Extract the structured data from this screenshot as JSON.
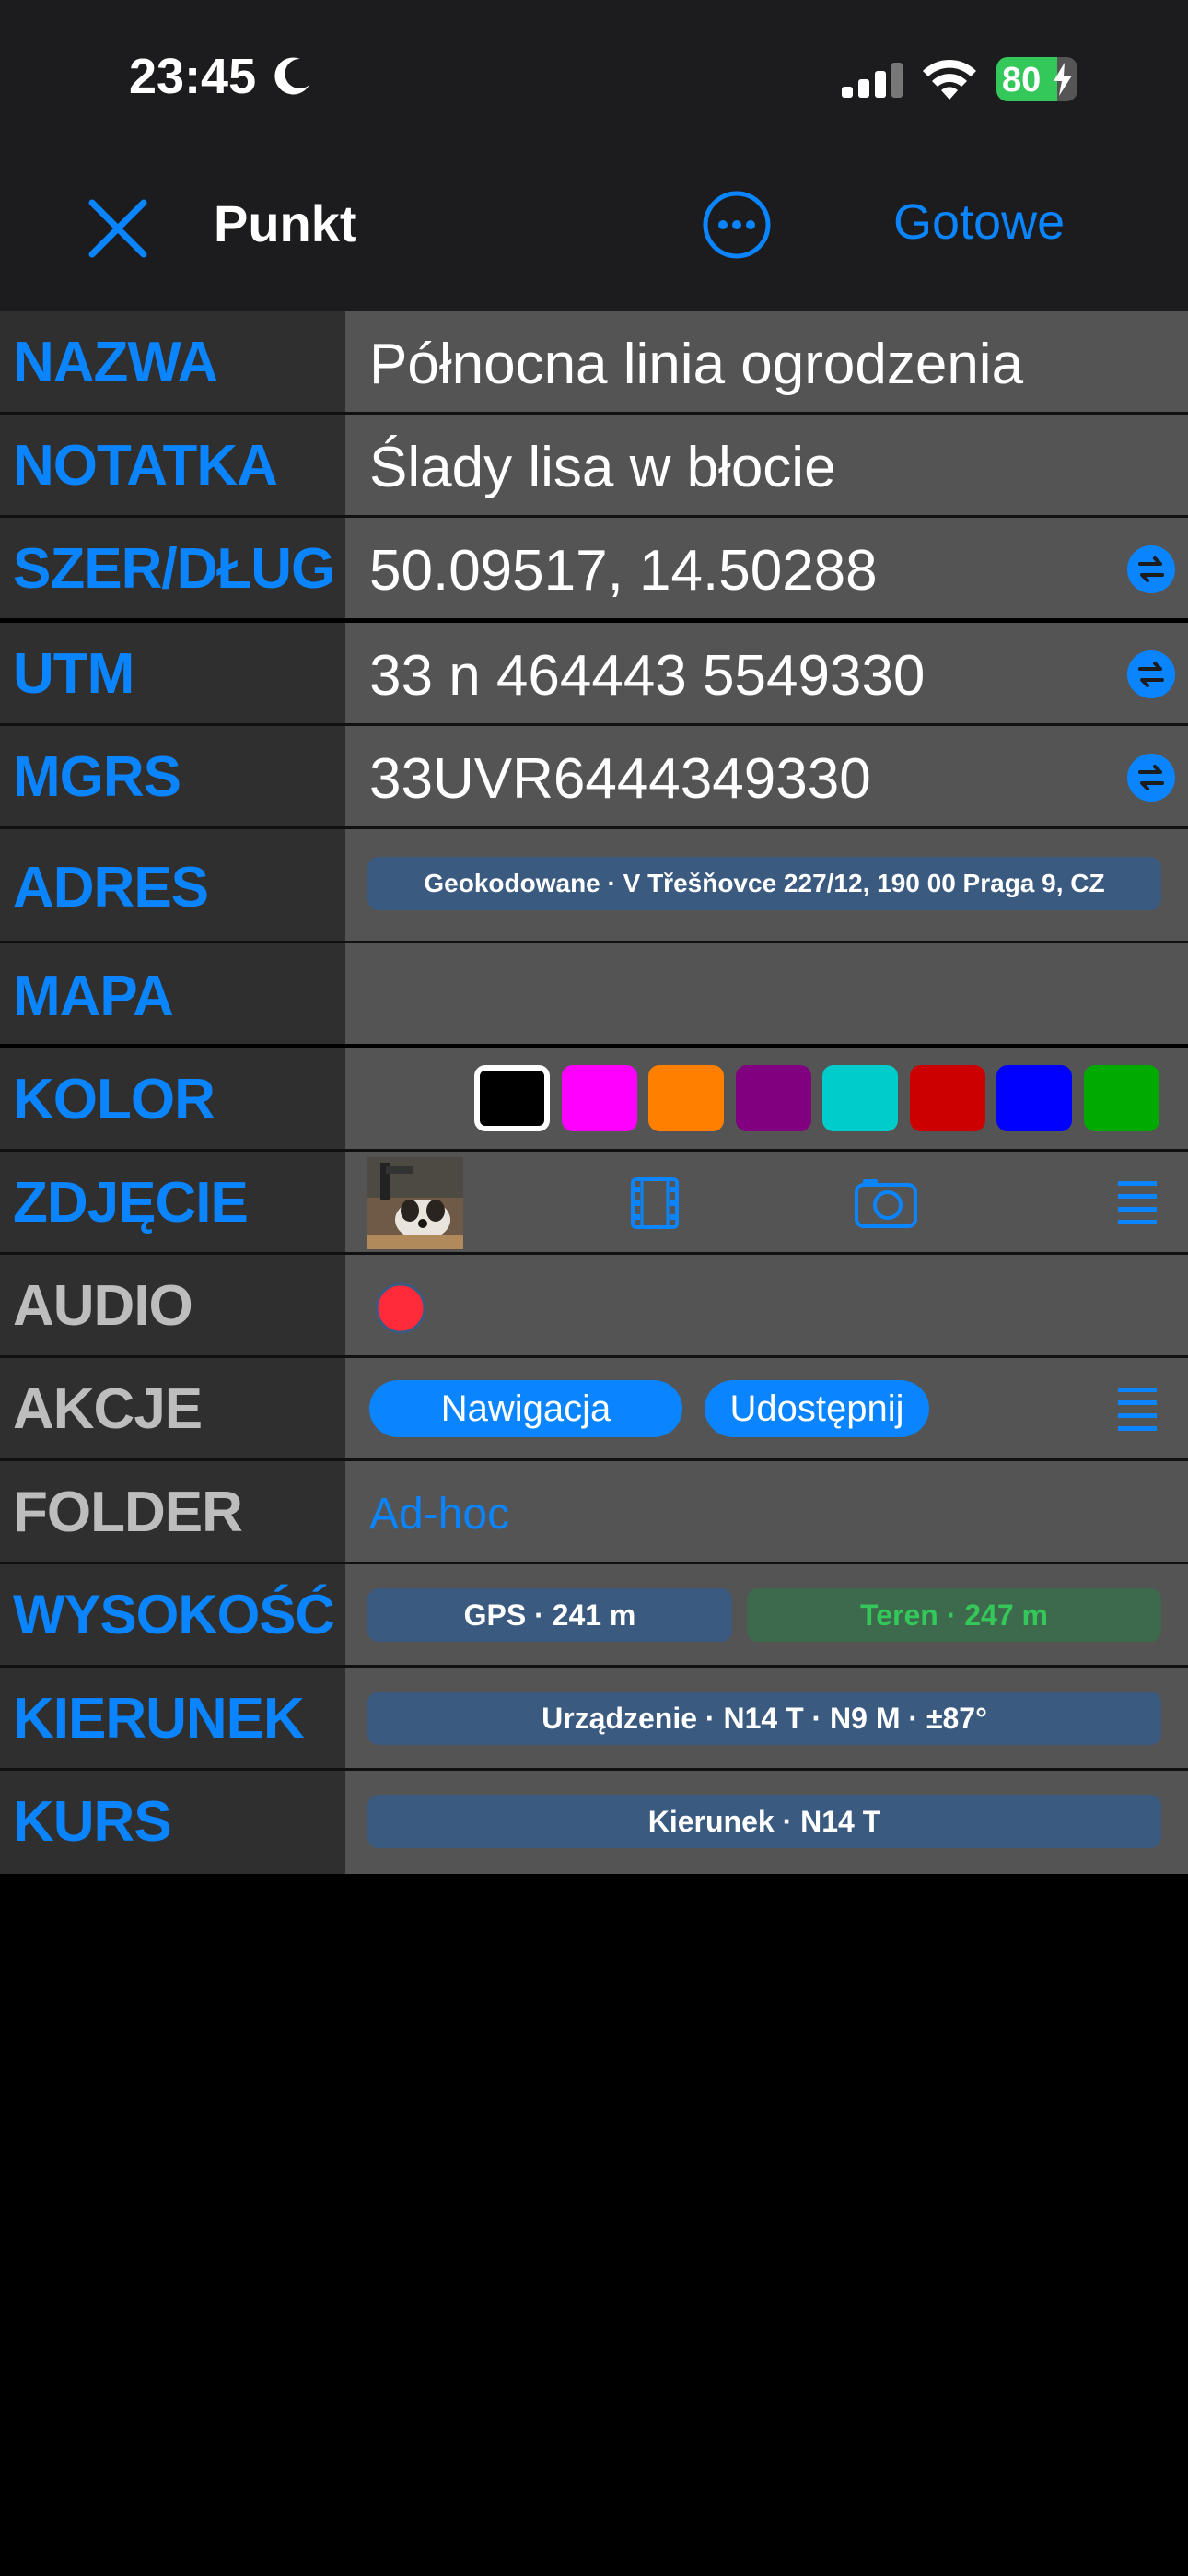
{
  "status": {
    "time": "23:45",
    "battery": "80"
  },
  "nav": {
    "title": "Punkt",
    "done_label": "Gotowe"
  },
  "rows": {
    "name": {
      "label": "NAZWA",
      "value": "Północna linia ogrodzenia"
    },
    "note": {
      "label": "NOTATKA",
      "value": "Ślady lisa w błocie"
    },
    "latlon": {
      "label": "SZER/DŁUG",
      "value": "50.09517, 14.50288"
    },
    "utm": {
      "label": "UTM",
      "value": "33 n 464443 5549330"
    },
    "mgrs": {
      "label": "MGRS",
      "value": "33UVR6444349330"
    },
    "address": {
      "label": "ADRES",
      "value": "Geokodowane · V Třešňovce 227/12, 190 00 Praga 9, CZ"
    },
    "map": {
      "label": "MAPA"
    },
    "color": {
      "label": "KOLOR",
      "swatches": [
        "#000000",
        "#ff00ff",
        "#ff8000",
        "#800080",
        "#00cccc",
        "#cc0000",
        "#0000ff",
        "#00aa00"
      ],
      "selected": "#000000"
    },
    "photo": {
      "label": "ZDJĘCIE"
    },
    "audio": {
      "label": "AUDIO"
    },
    "actions": {
      "label": "AKCJE",
      "navigate": "Nawigacja",
      "share": "Udostępnij"
    },
    "folder": {
      "label": "FOLDER",
      "value": "Ad-hoc"
    },
    "altitude": {
      "label": "WYSOKOŚĆ",
      "gps": "GPS · 241 m",
      "terrain": "Teren · 247 m"
    },
    "heading": {
      "label": "KIERUNEK",
      "value": "Urządzenie · N14 T · N9 M · ±87°"
    },
    "course": {
      "label": "KURS",
      "value": "Kierunek · N14 T"
    }
  },
  "colors": {
    "accent": "#0a84ff",
    "label_bg": "#2f2f2f",
    "value_bg": "#545454"
  }
}
